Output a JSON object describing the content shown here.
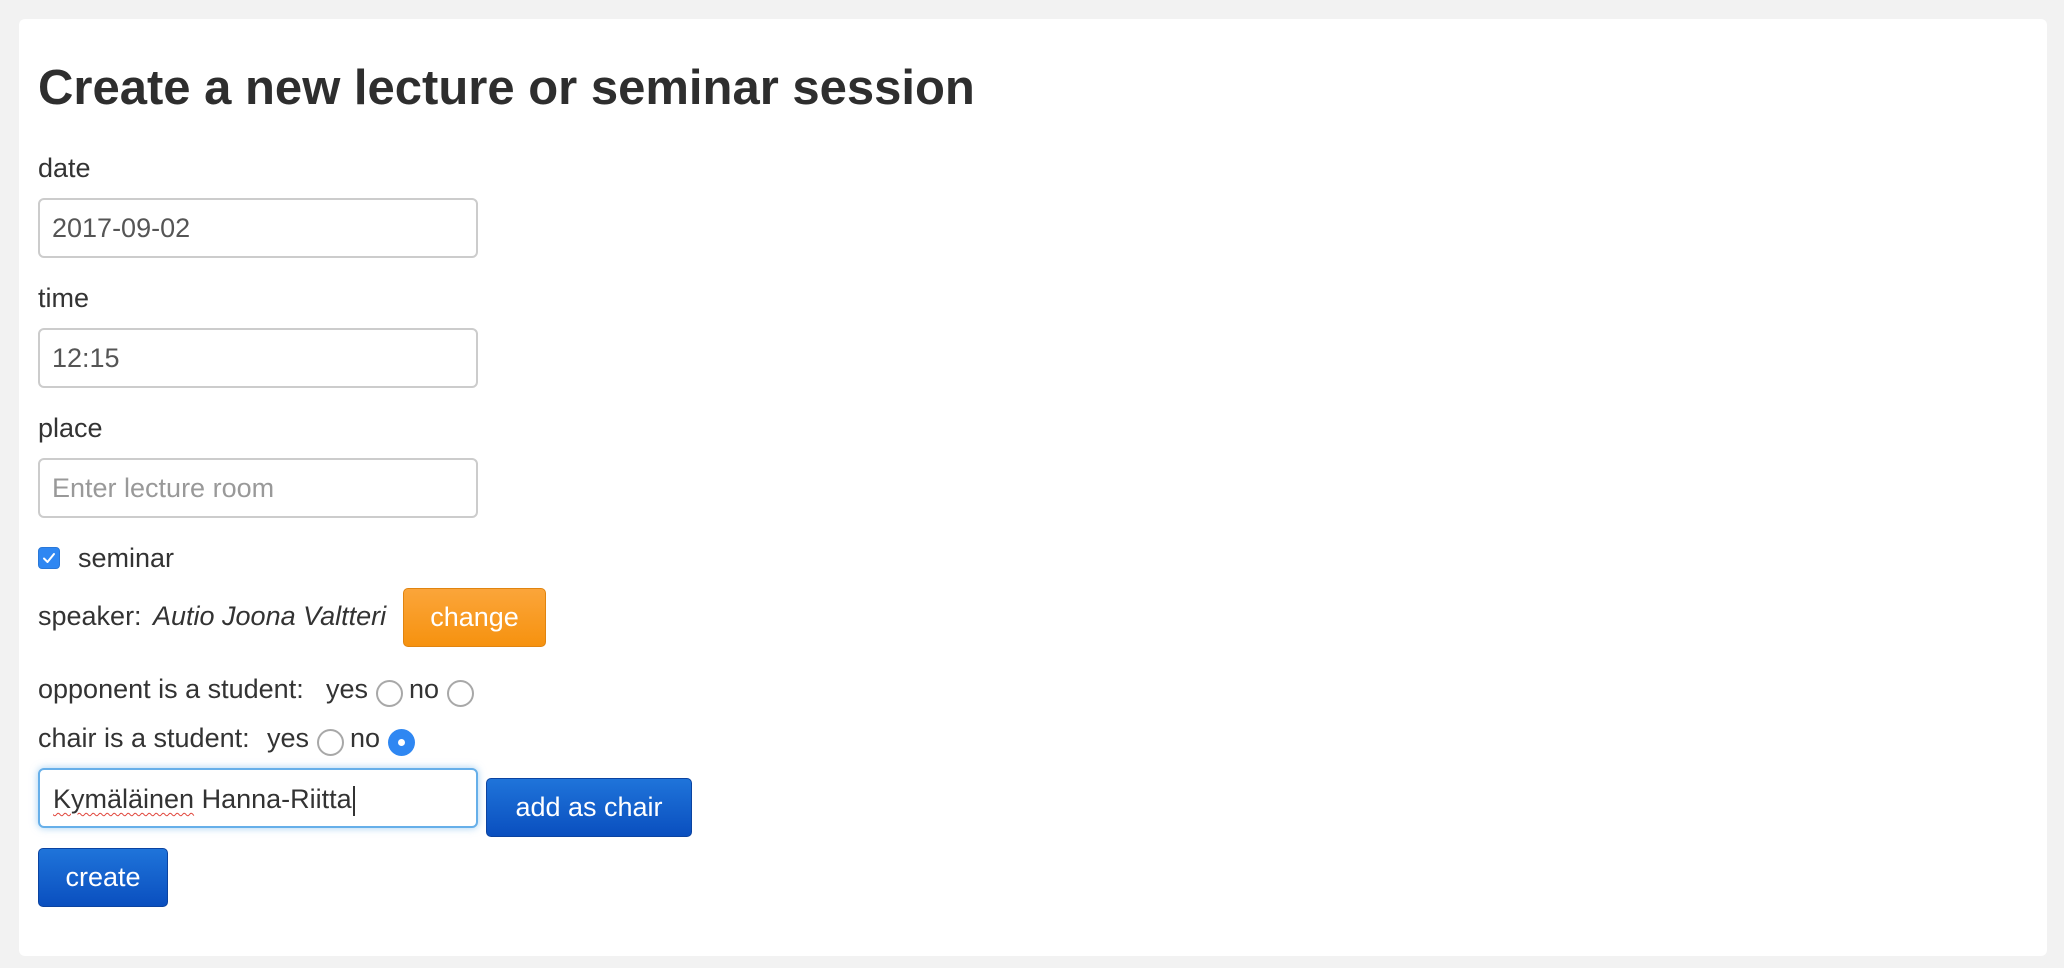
{
  "page": {
    "title": "Create a new lecture or seminar session"
  },
  "form": {
    "date": {
      "label": "date",
      "value": "2017-09-02"
    },
    "time": {
      "label": "time",
      "value": "12:15"
    },
    "place": {
      "label": "place",
      "value": "",
      "placeholder": "Enter lecture room"
    },
    "seminar": {
      "label": "seminar",
      "checked": true
    },
    "speaker": {
      "prefix": "speaker:",
      "name": "Autio Joona Valtteri",
      "change_label": "change"
    },
    "opponent_student": {
      "question": "opponent is a student:",
      "yes_label": "yes",
      "no_label": "no",
      "selected": "none"
    },
    "chair_student": {
      "question": "chair is a student:",
      "yes_label": "yes",
      "no_label": "no",
      "selected": "no"
    },
    "chair_name": {
      "value_misspelled_part": "Kymäläinen",
      "value_rest": " Hanna-Riitta",
      "add_label": "add as chair"
    },
    "create_label": "create"
  },
  "colors": {
    "accent_blue": "#2f87f2",
    "button_blue": "#0a4fbf",
    "button_orange": "#f6920f",
    "focus_ring": "#66afe9"
  }
}
